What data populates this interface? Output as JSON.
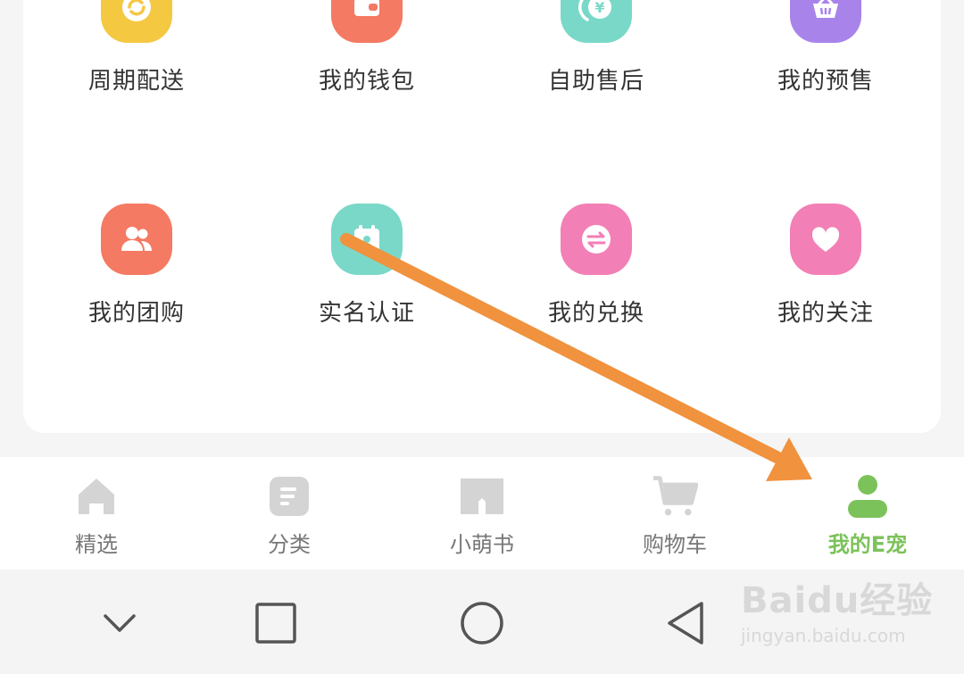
{
  "services": {
    "items": [
      {
        "label": "周期配送",
        "icon": "refresh-icon",
        "color": "#f5c842"
      },
      {
        "label": "我的钱包",
        "icon": "wallet-icon",
        "color": "#f47a63"
      },
      {
        "label": "自助售后",
        "icon": "yen-refund-icon",
        "color": "#7ad8c8"
      },
      {
        "label": "我的预售",
        "icon": "basket-icon",
        "color": "#a884ea"
      },
      {
        "label": "我的团购",
        "icon": "group-icon",
        "color": "#f47a63"
      },
      {
        "label": "实名认证",
        "icon": "calendar-id-icon",
        "color": "#7ad8c8"
      },
      {
        "label": "我的兑换",
        "icon": "exchange-icon",
        "color": "#f27fb5"
      },
      {
        "label": "我的关注",
        "icon": "heart-icon",
        "color": "#f27fb5"
      }
    ]
  },
  "tabbar": {
    "items": [
      {
        "label": "精选",
        "icon": "home-icon"
      },
      {
        "label": "分类",
        "icon": "category-icon"
      },
      {
        "label": "小萌书",
        "icon": "book-icon"
      },
      {
        "label": "购物车",
        "icon": "cart-icon"
      },
      {
        "label": "我的E宠",
        "icon": "profile-icon",
        "active": true
      }
    ],
    "active_color": "#7cc25a",
    "inactive_color": "#777777"
  },
  "system_nav": {
    "buttons": [
      "chevron-down-icon",
      "square-icon",
      "circle-icon",
      "back-triangle-icon"
    ]
  },
  "annotation": {
    "arrow_color": "#f0923e"
  },
  "watermark": {
    "main": "Baidu经验",
    "sub": "jingyan.baidu.com"
  }
}
